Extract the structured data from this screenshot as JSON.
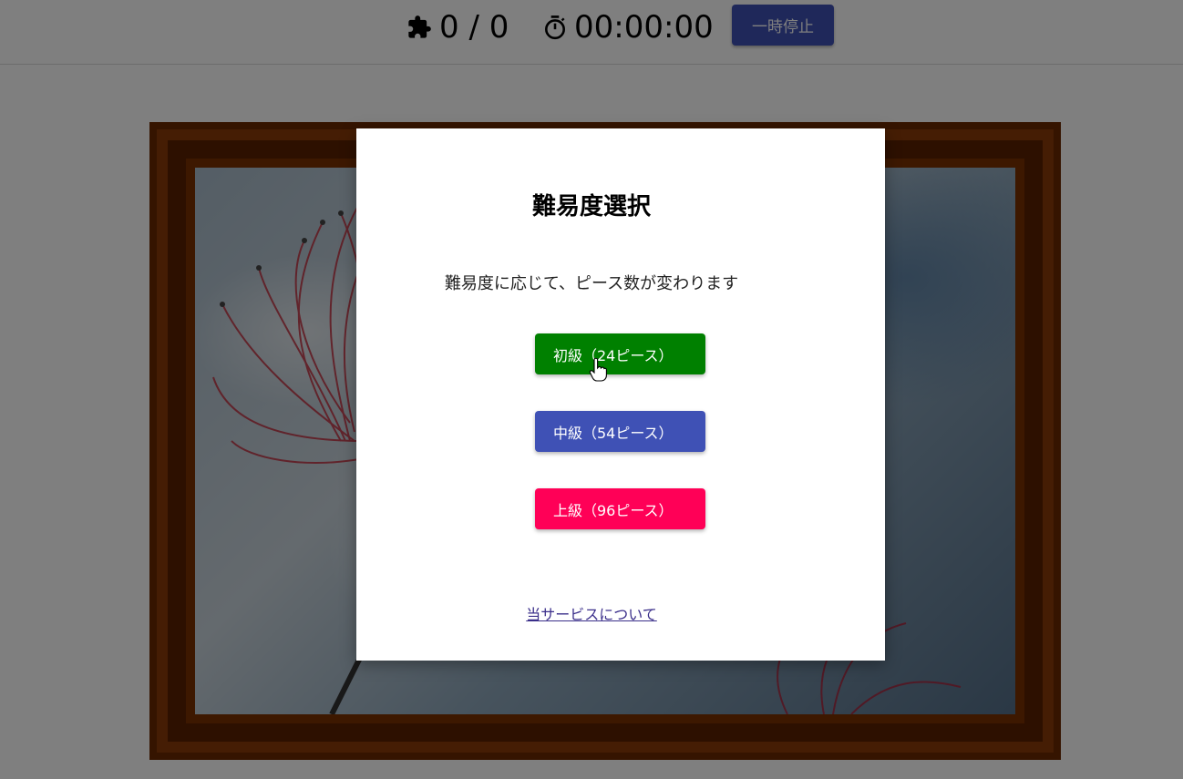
{
  "header": {
    "pieces_count": "0 / 0",
    "timer": "00:00:00",
    "pause_label": "一時停止"
  },
  "dialog": {
    "title": "難易度選択",
    "description": "難易度に応じて、ピース数が変わります",
    "buttons": [
      {
        "label": "初級（24ピース）",
        "color": "#008000"
      },
      {
        "label": "中級（54ピース）",
        "color": "#3f51b5"
      },
      {
        "label": "上級（96ピース）",
        "color": "#ff0057"
      }
    ],
    "about_link": "当サービスについて"
  },
  "icons": {
    "pieces": "puzzle-icon",
    "timer": "stopwatch-icon"
  }
}
